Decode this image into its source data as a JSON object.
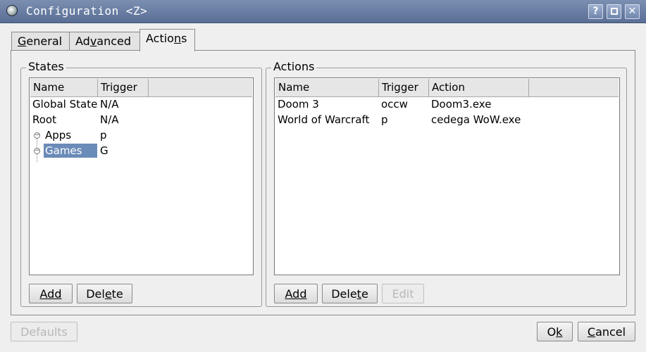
{
  "window": {
    "title": "Configuration <Z>",
    "controls": {
      "help": "?",
      "maximize": "□",
      "close": "✕"
    }
  },
  "tabs": [
    {
      "label": "General",
      "underline": "G",
      "rest": "eneral",
      "active": false
    },
    {
      "label": "Advanced",
      "pre": "Ad",
      "underline": "v",
      "rest": "anced",
      "active": false
    },
    {
      "label": "Actions",
      "pre": "Actio",
      "underline": "n",
      "rest": "s",
      "active": true
    }
  ],
  "states": {
    "group_title": "States",
    "columns": [
      "Name",
      "Trigger"
    ],
    "rows": [
      {
        "name": "Global State",
        "trigger": "N/A"
      },
      {
        "name": "Root",
        "trigger": "N/A"
      },
      {
        "name": "Apps",
        "trigger": "p",
        "child": true,
        "toggle": "⊖"
      },
      {
        "name": "Games",
        "trigger": "G",
        "child": true,
        "toggle": "⊖",
        "selected": true
      }
    ],
    "buttons": {
      "add": "Add",
      "delete_pre": "Del",
      "delete_u": "e",
      "delete_rest": "te"
    }
  },
  "actions": {
    "group_title": "Actions",
    "columns": [
      "Name",
      "Trigger",
      "Action"
    ],
    "rows": [
      {
        "name": "Doom 3",
        "trigger": "occw",
        "action": "Doom3.exe"
      },
      {
        "name": "World of Warcraft",
        "trigger": "p",
        "action": "cedega WoW.exe"
      }
    ],
    "buttons": {
      "add": "Add",
      "delete_pre": "Dele",
      "delete_u": "t",
      "delete_rest": "e",
      "edit": "Edit"
    }
  },
  "footer": {
    "defaults": "Defaults",
    "ok_pre": "O",
    "ok_u": "k",
    "cancel_u": "C",
    "cancel_rest": "ancel"
  }
}
